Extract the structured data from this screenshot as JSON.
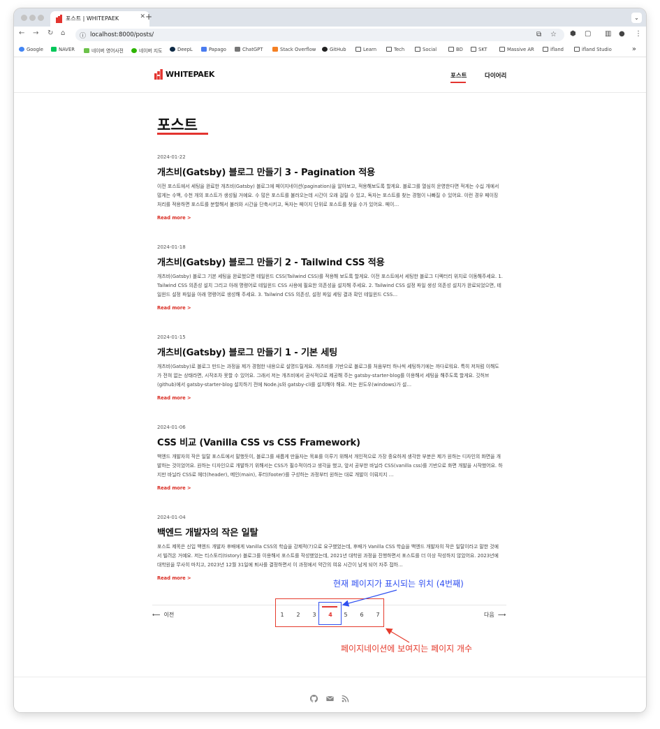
{
  "browser": {
    "tab_title": "포스트 | WHITEPAEK",
    "url": "localhost:8000/posts/",
    "bookmarks": [
      "Google",
      "NAVER",
      "네이버 영어사전",
      "네이버 지도",
      "DeepL",
      "Papago",
      "ChatGPT",
      "Stack Overflow",
      "GitHub",
      "Learn",
      "Tech",
      "Social",
      "BD",
      "SKT",
      "Massive AR",
      "ifland",
      "ifland Studio"
    ]
  },
  "site": {
    "logo_text": "WHITEPAEK",
    "nav": {
      "posts": "포스트",
      "diary": "다이어리"
    },
    "accent_color": "#e3342f"
  },
  "main": {
    "title": "포스트",
    "posts": [
      {
        "date": "2024-01-22",
        "title": "개츠비(Gatsby) 블로그 만들기 3 - Pagination 적용",
        "excerpt": "이전 포스트에서 세팅을 완료한 개츠비(Gatsby) 블로그에 페이지네이션(pagination)을 알아보고, 적용해보도록 할게요. 블로그를 열심히 운영한다면 적게는 수십 개에서 많게는 수백, 수천 개의 포스트가 생성될 거예요. 수 많은 포스트를 불러오는데 시간이 오래 걸릴 수 있고, 독자는 포스트를 찾는 경험이 나빠질 수 있어요. 이런 경우 페이징 처리를 적용하면 포스트를 분할해서 불러와 시간을 단축시키고, 독자는 페이지 단위로 포스트를 찾을 수가 있어요. 페이…",
        "read_more": "Read more >"
      },
      {
        "date": "2024-01-18",
        "title": "개츠비(Gatsby) 블로그 만들기 2 - Tailwind CSS 적용",
        "excerpt": "개츠비(Gatsby) 블로그 기본 세팅을 완료했으면 테일윈드 CSS(Tailwind CSS)를 적용해 보도록 할게요. 이전 포스트에서 세팅한 블로그 디렉터리 위치로 이동해주세요. 1. Tailwind CSS 의존성 설치 그리고 아래 명령어로 테일윈드 CSS 사용에 필요한 의존성을 설치해 주세요. 2. Tailwind CSS 설정 파일 생성 의존성 설치가 완료되었으면, 테일윈드 설정 파일을 아래 명령어로 생성해 주세요. 3. Tailwind CSS 의존성, 설정 파일 세팅 결과 확인 테일윈드 CSS…",
        "read_more": "Read more >"
      },
      {
        "date": "2024-01-15",
        "title": "개츠비(Gatsby) 블로그 만들기 1 - 기본 세팅",
        "excerpt": "개츠비(Gatsby)로 블로그 만드는 과정을 제가 경험한 내용으로 설명드릴게요. 개츠비를 기반으로 블로그를 처음부터 하나씩 세팅하기에는 까다로워요. 특히 저처럼 이해도가 전혀 없는 상태라면, 시작조차 못할 수 있어요. 그래서 저는 개츠비에서 공식적으로 제공해 주는 gatsby-starter-blog를 이용해서 세팅을 해주도록 할게요. 깃허브(github)에서 gatsby-starter-blog 설치하기 전에 Node.js와 gatsby-cli를 설치해야 해요. 저는 윈도우(windows)가 설…",
        "read_more": "Read more >"
      },
      {
        "date": "2024-01-06",
        "title": "CSS 비교 (Vanilla CSS vs CSS Framework)",
        "excerpt": "백엔드 개발자의 작은 일탈 포스트에서 말했듯이, 블로그를 새롭게 만들자는 목표를 이루기 위해서 개인적으로 가장 중요하게 생각한 부분은 제가 원하는 디자인의 화면을 개발하는 것이었어요. 원하는 디자인으로 개발하기 위해서는 CSS가 필수적이라고 생각을 했고, 앞서 공부한 바닐라 CSS(vanilla css)를 기반으로 화면 개발을 시작했어요. 하지만 바닐라 CSS로 헤더(header), 메인(main), 푸터(footer)를 구성하는 과정부터 원하는 대로 개발이 이뤄지지 …",
        "read_more": "Read more >"
      },
      {
        "date": "2024-01-04",
        "title": "백엔드 개발자의 작은 일탈",
        "excerpt": "포스트 제목은 신입 백엔드 개발자 후배에게 Vanilla CSS의 학습을 강제적(?)으로 요구했었는데, 후배가 Vanilla CSS 학습을 백엔드 개발자의 작은 일탈이라고 말한 것에서 빌려온 거예요. 저는 티스토리(tistory) 블로그를 이용해서 포스트를 작성했었는데, 2021년 대학원 과정을 진행하면서 포스트를 더 이상 작성하지 않았어요. 2023년에 대학원을 무사히 마치고, 2023년 12월 31일에 퇴사를 결정하면서 이 과정에서 약간의 여유 시간이 남게 되어 자주 접하…",
        "read_more": "Read more >"
      }
    ]
  },
  "pagination": {
    "prev": "이전",
    "next": "다음",
    "pages": [
      "1",
      "2",
      "3",
      "4",
      "5",
      "6",
      "7"
    ],
    "current_page": "4"
  },
  "annotations": {
    "current_position": "현재 페이지가 표시되는 위치 (4번째)",
    "page_count": "페이지네이션에 보여지는 페이지 개수",
    "blue_color": "#2f4ff0",
    "red_color": "#e53b2c"
  },
  "footer": {
    "icons": [
      "github-icon",
      "mail-icon",
      "rss-icon"
    ]
  }
}
